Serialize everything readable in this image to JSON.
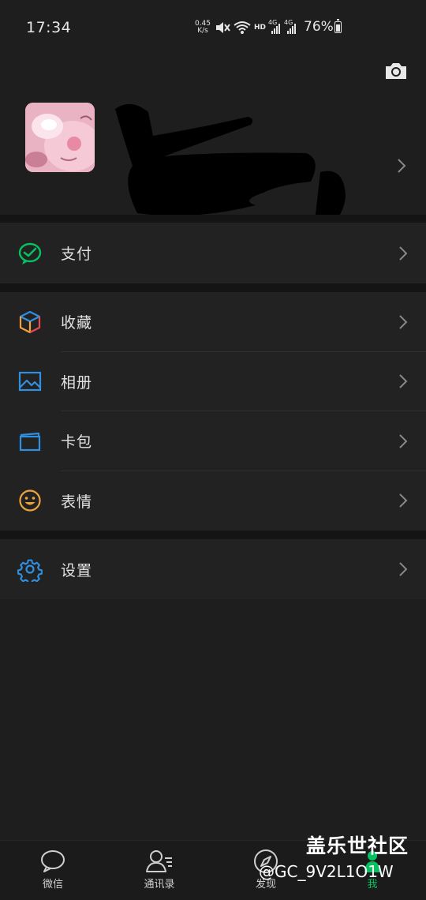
{
  "status_bar": {
    "time": "17:34",
    "net_speed_value": "0.45",
    "net_speed_unit": "K/s",
    "hd": "HD",
    "sim1_type": "4G",
    "sim2_type": "4G",
    "battery_percent": "76%",
    "icons": [
      "mute-vibrate-icon",
      "wifi-icon",
      "signal-icon",
      "battery-icon"
    ]
  },
  "header": {
    "camera_icon": "camera-icon"
  },
  "profile": {
    "avatar_icon": "avatar-image",
    "name_redacted": true
  },
  "menu": {
    "pay": {
      "label": "支付",
      "icon": "wechat-pay-icon",
      "color": "#07c160"
    },
    "groups": [
      {
        "label": "收藏",
        "icon": "favorites-cube-icon"
      },
      {
        "label": "相册",
        "icon": "album-image-icon",
        "color": "#2f8fe0"
      },
      {
        "label": "卡包",
        "icon": "card-wallet-icon",
        "color": "#2f8fe0"
      },
      {
        "label": "表情",
        "icon": "sticker-smile-icon",
        "color": "#f0a33a"
      }
    ],
    "settings": {
      "label": "设置",
      "icon": "settings-gear-icon",
      "color": "#2f8fe0"
    }
  },
  "bottom_nav": {
    "tabs": [
      {
        "label": "微信",
        "icon": "chat-bubble-icon"
      },
      {
        "label": "通讯录",
        "icon": "contacts-icon"
      },
      {
        "label": "发现",
        "icon": "discover-compass-icon"
      },
      {
        "label": "我",
        "icon": "me-person-icon",
        "active": true
      }
    ],
    "active_color": "#07c160"
  },
  "watermark": {
    "title": "盖乐世社区",
    "user": "@GC_9V2L1O1W"
  }
}
